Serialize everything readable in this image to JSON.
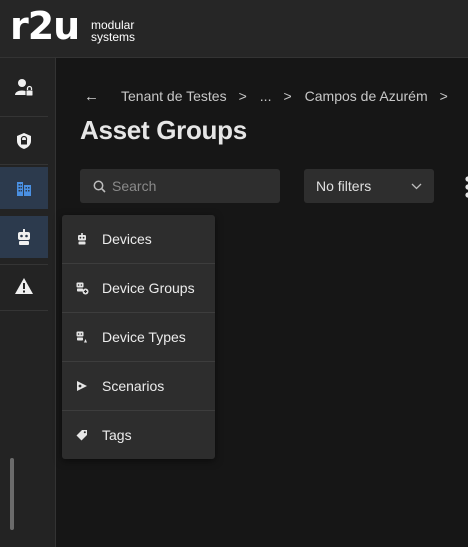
{
  "brand": {
    "mark": "r2u",
    "line1": "modular",
    "line2": "systems"
  },
  "sidebar": {
    "items": [
      {
        "icon": "user-lock-icon"
      },
      {
        "icon": "shield-icon"
      },
      {
        "icon": "buildings-icon"
      },
      {
        "icon": "robot-icon"
      },
      {
        "icon": "warning-icon"
      }
    ]
  },
  "breadcrumb": {
    "back_icon": "arrow-left-icon",
    "items": [
      "Tenant de Testes",
      "...",
      "Campos de Azurém"
    ],
    "separator": ">"
  },
  "page": {
    "title": "Asset Groups"
  },
  "search": {
    "placeholder": "Search"
  },
  "filter": {
    "value": "No filters"
  },
  "menu": {
    "items": [
      {
        "label": "Devices",
        "icon": "robot-icon"
      },
      {
        "label": "Device Groups",
        "icon": "robot-group-icon"
      },
      {
        "label": "Device Types",
        "icon": "robot-type-icon"
      },
      {
        "label": "Scenarios",
        "icon": "scenario-icon"
      },
      {
        "label": "Tags",
        "icon": "tag-icon"
      }
    ]
  },
  "colors": {
    "accent": "#4a90e2",
    "active_bg": "#2c3a4d",
    "background": "#161616"
  }
}
